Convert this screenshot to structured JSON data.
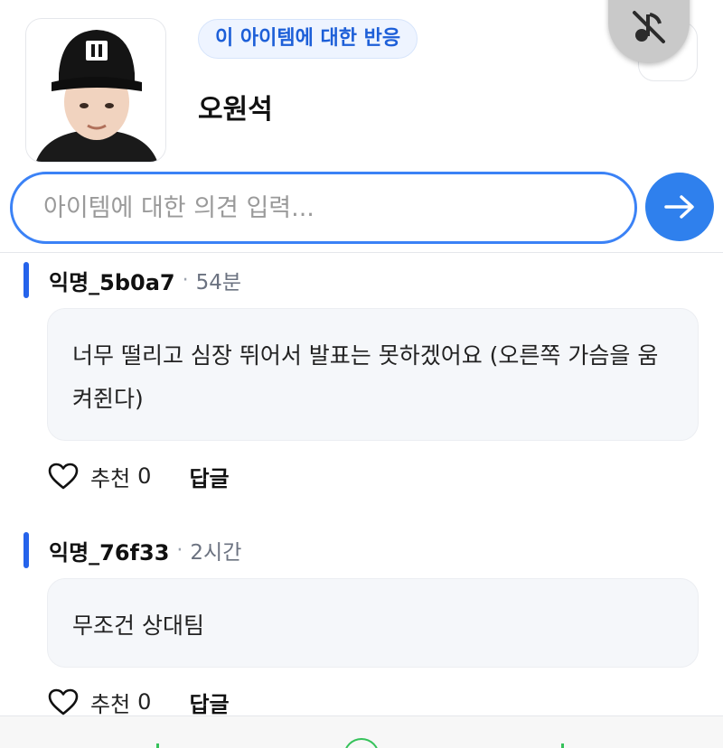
{
  "header": {
    "badge": "이 아이템에 대한 반응",
    "item_name": "오원석"
  },
  "composer": {
    "placeholder": "아이템에 대한 의견 입력..."
  },
  "comments": [
    {
      "author": "익명_5b0a7",
      "separator": "·",
      "time": "54분",
      "text": "너무 떨리고 심장 뛰어서 발표는 못하겠어요 (오른쪽 가슴을 움켜쥔다)",
      "like_label": "추천",
      "like_count": "0",
      "reply_label": "답글"
    },
    {
      "author": "익명_76f33",
      "separator": "·",
      "time": "2시간",
      "text": "무조건 상대팀",
      "like_label": "추천",
      "like_count": "0",
      "reply_label": "답글"
    }
  ],
  "colors": {
    "accent": "#2f80ed",
    "comment_bar": "#2563eb",
    "badge_text": "#1d5fd8"
  },
  "icons": [
    "mute-icon",
    "search-icon",
    "send-arrow-icon",
    "heart-icon"
  ]
}
